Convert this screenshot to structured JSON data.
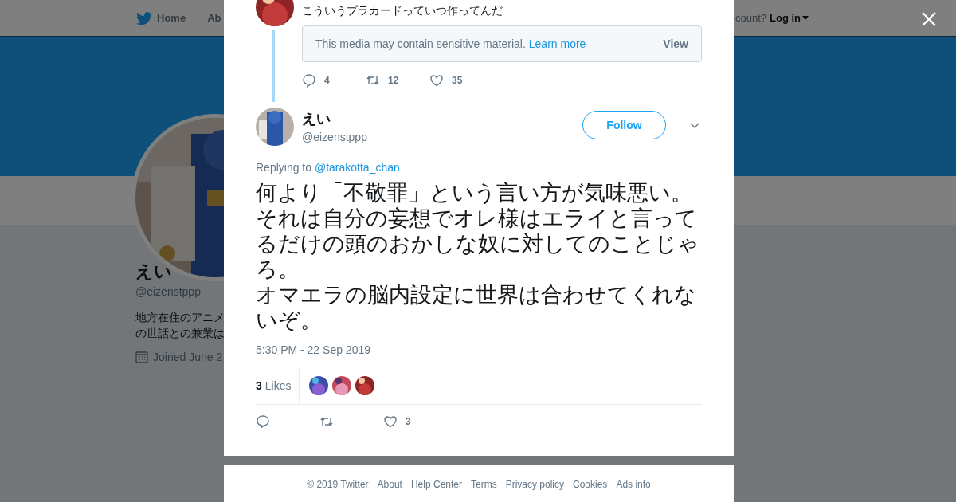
{
  "background_page": {
    "nav": [
      {
        "label": "Home"
      },
      {
        "label": "Ab"
      }
    ],
    "login_prompt": "count?",
    "login": "Log in",
    "profile": {
      "name": "えい",
      "handle": "@eizenstppp",
      "bio": [
        "地方在住のアニメ",
        "の世話との兼業は"
      ],
      "joined": "Joined June 2"
    }
  },
  "dialog": {
    "previous_tweet": {
      "text": "こういうプラカードっていつ作ってんだ",
      "media_notice": "This media may contain sensitive material.",
      "learn_more": "Learn more",
      "view": "View",
      "actions": [
        {
          "kind": "reply",
          "count": "4"
        },
        {
          "kind": "retweet",
          "count": "12"
        },
        {
          "kind": "like",
          "count": "35"
        }
      ]
    },
    "tweet": {
      "name": "えい",
      "handle": "@eizenstppp",
      "follow": "Follow",
      "replying_label": "Replying to",
      "replying_to": "@tarakotta_chan",
      "text": [
        "何より「不敬罪」という言い方が気味悪い。",
        "それは自分の妄想でオレ様はエライと言ってるだけの頭のおかしな奴に対してのことじゃろ。",
        "オマエラの脳内設定に世界は合わせてくれないぞ。"
      ],
      "timestamp": "5:30 PM - 22 Sep 2019",
      "likes_count": "3",
      "likes_label": "Likes",
      "actions": [
        {
          "kind": "reply"
        },
        {
          "kind": "retweet"
        },
        {
          "kind": "like",
          "count": "3"
        }
      ]
    }
  },
  "footer": [
    "© 2019 Twitter",
    "About",
    "Help Center",
    "Terms",
    "Privacy policy",
    "Cookies",
    "Ads info"
  ]
}
